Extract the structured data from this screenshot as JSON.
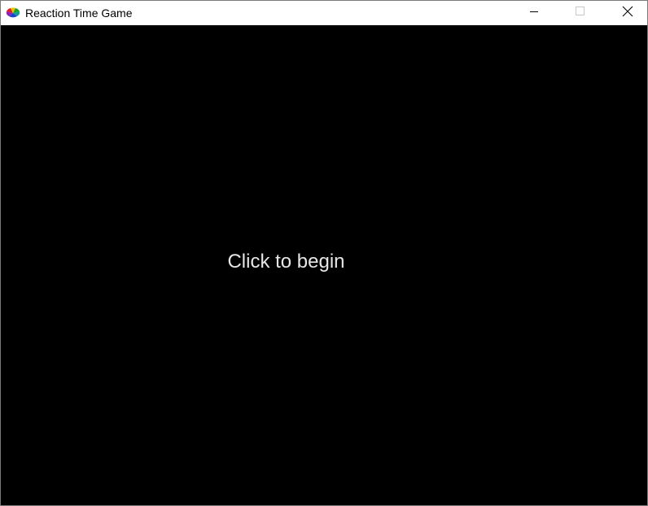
{
  "window": {
    "title": "Reaction Time Game",
    "app_icon": "color-wheel-icon",
    "controls": {
      "minimize_icon": "minimize-icon",
      "maximize_icon": "maximize-icon",
      "close_icon": "close-icon",
      "maximize_enabled": false
    }
  },
  "game": {
    "background_color": "#000000",
    "prompt": "Click to begin",
    "prompt_color": "#e6e6e6"
  }
}
